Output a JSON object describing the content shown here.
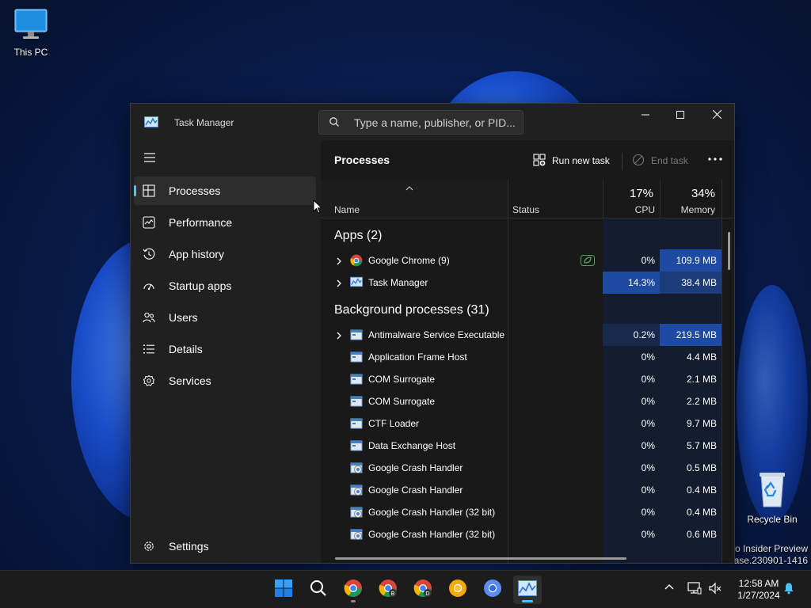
{
  "desktop": {
    "this_pc_label": "This PC",
    "recycle_bin_label": "Recycle Bin",
    "watermark_line1": "ro Insider Preview",
    "watermark_line2": "ease.230901-1416"
  },
  "window": {
    "title": "Task Manager",
    "search_placeholder": "Type a name, publisher, or PID..."
  },
  "sidebar": {
    "items": [
      {
        "label": "Processes",
        "icon": "processes-icon",
        "active": true
      },
      {
        "label": "Performance",
        "icon": "performance-icon"
      },
      {
        "label": "App history",
        "icon": "history-icon"
      },
      {
        "label": "Startup apps",
        "icon": "startup-icon"
      },
      {
        "label": "Users",
        "icon": "users-icon"
      },
      {
        "label": "Details",
        "icon": "details-icon"
      },
      {
        "label": "Services",
        "icon": "services-icon"
      }
    ],
    "settings_label": "Settings"
  },
  "toolbar": {
    "title": "Processes",
    "run_new_task": "Run new task",
    "end_task": "End task"
  },
  "columns": {
    "name": "Name",
    "status": "Status",
    "cpu_total": "17%",
    "cpu": "CPU",
    "memory_total": "34%",
    "memory": "Memory"
  },
  "groups": {
    "apps": "Apps (2)",
    "background": "Background processes (31)"
  },
  "apps": [
    {
      "name": "Google Chrome (9)",
      "cpu": "0%",
      "memory": "109.9 MB",
      "icon": "chrome-icon",
      "expandable": true,
      "status_icon": "efficiency-leaf-icon"
    },
    {
      "name": "Task Manager",
      "cpu": "14.3%",
      "memory": "38.4 MB",
      "icon": "taskmanager-icon",
      "expandable": true
    }
  ],
  "background": [
    {
      "name": "Antimalware Service Executable",
      "cpu": "0.2%",
      "memory": "219.5 MB",
      "icon": "process-icon",
      "expandable": true
    },
    {
      "name": "Application Frame Host",
      "cpu": "0%",
      "memory": "4.4 MB",
      "icon": "process-icon"
    },
    {
      "name": "COM Surrogate",
      "cpu": "0%",
      "memory": "2.1 MB",
      "icon": "process-icon"
    },
    {
      "name": "COM Surrogate",
      "cpu": "0%",
      "memory": "2.2 MB",
      "icon": "process-icon"
    },
    {
      "name": "CTF Loader",
      "cpu": "0%",
      "memory": "9.7 MB",
      "icon": "process-icon"
    },
    {
      "name": "Data Exchange Host",
      "cpu": "0%",
      "memory": "5.7 MB",
      "icon": "process-icon"
    },
    {
      "name": "Google Crash Handler",
      "cpu": "0%",
      "memory": "0.5 MB",
      "icon": "crash-handler-icon"
    },
    {
      "name": "Google Crash Handler",
      "cpu": "0%",
      "memory": "0.4 MB",
      "icon": "crash-handler-icon"
    },
    {
      "name": "Google Crash Handler (32 bit)",
      "cpu": "0%",
      "memory": "0.4 MB",
      "icon": "crash-handler-icon"
    },
    {
      "name": "Google Crash Handler (32 bit)",
      "cpu": "0%",
      "memory": "0.6 MB",
      "icon": "crash-handler-icon"
    }
  ],
  "taskbar": {
    "time": "12:58 AM",
    "date": "1/27/2024"
  },
  "colors": {
    "accent": "#4cc2ff",
    "heat_low": "#17284a",
    "heat_mid": "#1c3d7a",
    "heat_high": "#1f4aa3"
  }
}
